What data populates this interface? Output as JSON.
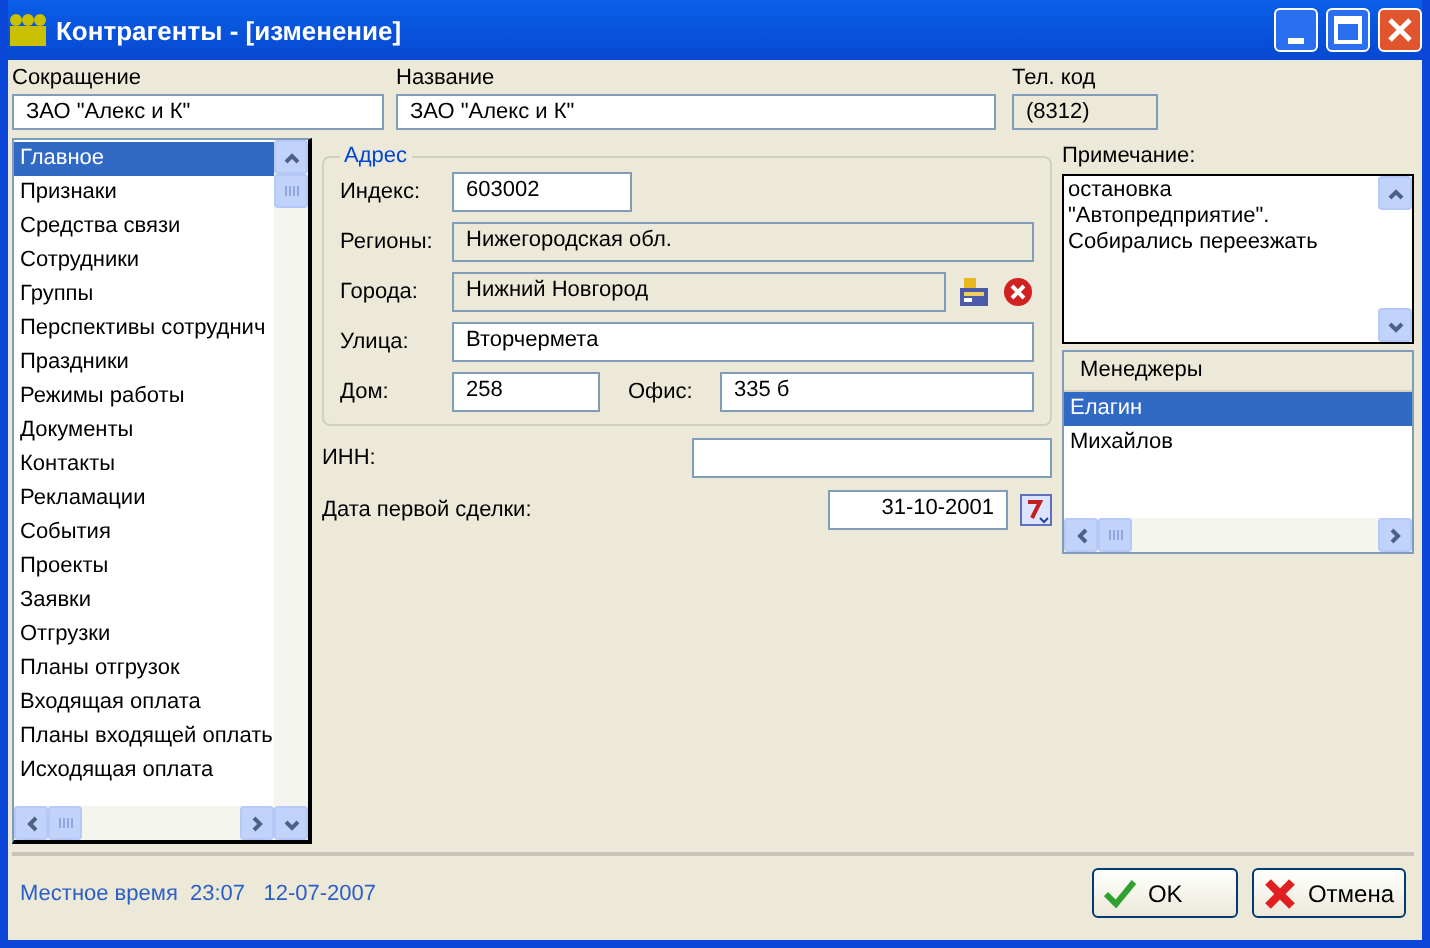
{
  "window": {
    "title": "Контрагенты - [изменение]"
  },
  "top_fields": [
    {
      "label": "Сокращение",
      "value": "ЗАО \"Алекс и К\"",
      "kind": "input"
    },
    {
      "label": "Название",
      "value": "ЗАО \"Алекс и К\"",
      "kind": "input"
    },
    {
      "label": "Тел. код",
      "value": "(8312)",
      "kind": "readonly"
    }
  ],
  "sidebar": {
    "items": [
      {
        "label": "Главное",
        "selected": true
      },
      {
        "label": "Признаки",
        "selected": false
      },
      {
        "label": "Средства связи",
        "selected": false
      },
      {
        "label": "Сотрудники",
        "selected": false
      },
      {
        "label": "Группы",
        "selected": false
      },
      {
        "label": "Перспективы сотруднич",
        "selected": false
      },
      {
        "label": "Праздники",
        "selected": false
      },
      {
        "label": "Режимы работы",
        "selected": false
      },
      {
        "label": "Документы",
        "selected": false
      },
      {
        "label": "Контакты",
        "selected": false
      },
      {
        "label": "Рекламации",
        "selected": false
      },
      {
        "label": "События",
        "selected": false
      },
      {
        "label": "Проекты",
        "selected": false
      },
      {
        "label": "Заявки",
        "selected": false
      },
      {
        "label": "Отгрузки",
        "selected": false
      },
      {
        "label": "Планы отгрузок",
        "selected": false
      },
      {
        "label": "Входящая оплата",
        "selected": false
      },
      {
        "label": "Планы входящей оплать",
        "selected": false
      },
      {
        "label": "Исходящая оплата",
        "selected": false
      }
    ]
  },
  "address": {
    "legend": "Адрес",
    "index": {
      "label": "Индекс:",
      "value": "603002"
    },
    "region": {
      "label": "Регионы:",
      "value": "Нижегородская обл."
    },
    "city": {
      "label": "Города:",
      "value": "Нижний Новгород"
    },
    "street": {
      "label": "Улица:",
      "value": "Вторчермета"
    },
    "house": {
      "label": "Дом:",
      "value": "258"
    },
    "office": {
      "label": "Офис:",
      "value": "335 б"
    }
  },
  "inn": {
    "label": "ИНН:"
  },
  "first_deal": {
    "label": "Дата первой сделки:",
    "value": "31-10-2001"
  },
  "note": {
    "label": "Примечание:",
    "value": "остановка\n\"Автопредприятие\".\nСобирались переезжать"
  },
  "managers": {
    "header": "Менеджеры",
    "items": [
      {
        "label": "Елагин",
        "selected": true
      },
      {
        "label": "Михайлов",
        "selected": false
      }
    ]
  },
  "status_bar": {
    "label": "Местное время",
    "time": "23:07",
    "date": "12-07-2007"
  },
  "buttons": [
    {
      "label": "OK",
      "kind": "ok"
    },
    {
      "label": "Отмена",
      "kind": "cancel"
    }
  ]
}
